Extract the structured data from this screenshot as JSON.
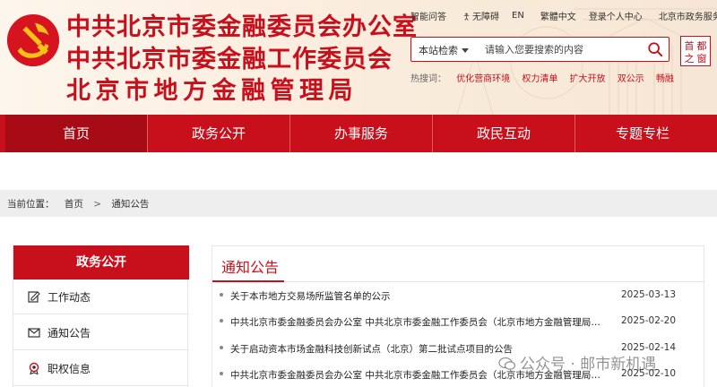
{
  "header": {
    "titles": [
      "中共北京市委金融委员会办公室",
      "中共北京市委金融工作委员会",
      "北京市地方金融管理局"
    ],
    "top_links": [
      "智能问答",
      "无障碍",
      "EN",
      "繁體中文",
      "登录个人中心",
      "北京市政务服务网"
    ],
    "search": {
      "scope": "本站检索",
      "placeholder": "请输入您要搜索的内容"
    },
    "hot": {
      "label": "热搜词：",
      "items": [
        "优化营商环境",
        "权力清单",
        "扩大开放",
        "双公示",
        "畅融"
      ]
    },
    "capital_logo_text": [
      "首",
      "都",
      "之",
      "窗"
    ]
  },
  "nav": {
    "items": [
      "首页",
      "政务公开",
      "办事服务",
      "政民互动",
      "专题专栏"
    ],
    "active": 0
  },
  "breadcrumb": {
    "label": "当前位置：",
    "items": [
      "首页",
      "通知公告"
    ],
    "separator": ">"
  },
  "sidebar": {
    "title": "政务公开",
    "items": [
      {
        "label": "工作动态",
        "icon": "edit-icon"
      },
      {
        "label": "通知公告",
        "icon": "mail-icon"
      },
      {
        "label": "职权信息",
        "icon": "badge-icon"
      }
    ]
  },
  "main": {
    "title": "通知公告",
    "list": [
      {
        "title": "关于本市地方交易场所监管名单的公示",
        "date": "2025-03-13"
      },
      {
        "title": "中共北京市委金融委员会办公室 中共北京市委金融工作委员会（北京市地方金融管理局）...",
        "date": "2025-02-20"
      },
      {
        "title": "关于启动资本市场金融科技创新试点（北京）第二批试点项目的公告",
        "date": "2025-02-14"
      },
      {
        "title": "中共北京市委金融委员会办公室 中共北京市委金融工作委员会（北京市地方金融管理局）...",
        "date": "2025-02-10"
      }
    ]
  },
  "watermark": "公众号 · 邮市新机遇",
  "colors": {
    "brand_red": "#c8101c",
    "nav_active": "#a70b15",
    "emblem_yellow": "#f6c21a"
  }
}
